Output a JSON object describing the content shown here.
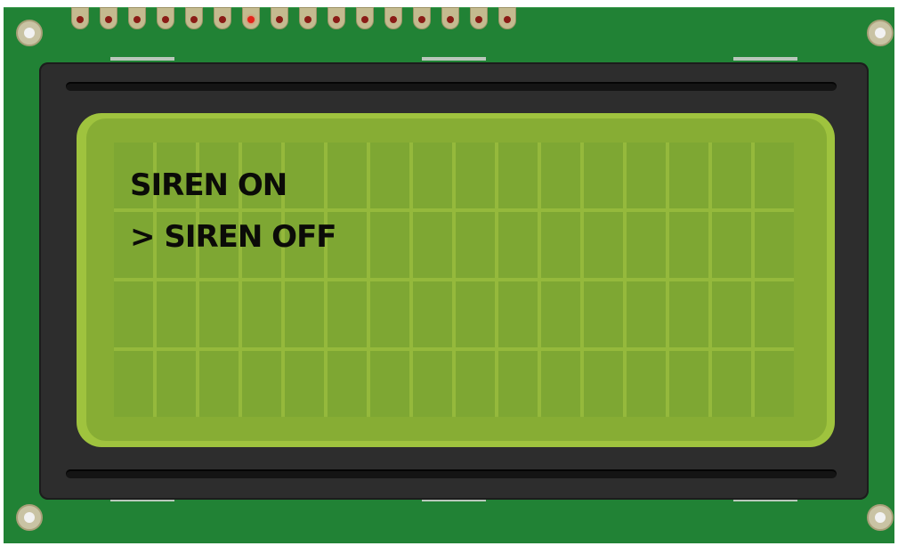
{
  "device": {
    "type": "lcd-display-module",
    "board_color": "#218235",
    "screen_color": "#87ad34",
    "text_color": "#0b0b08"
  },
  "pins": {
    "count": 16,
    "active_index": 6
  },
  "display": {
    "columns": 16,
    "rows": 4,
    "line1": "SIREN ON",
    "line2": "> SIREN OFF",
    "line3": "",
    "line4": ""
  }
}
